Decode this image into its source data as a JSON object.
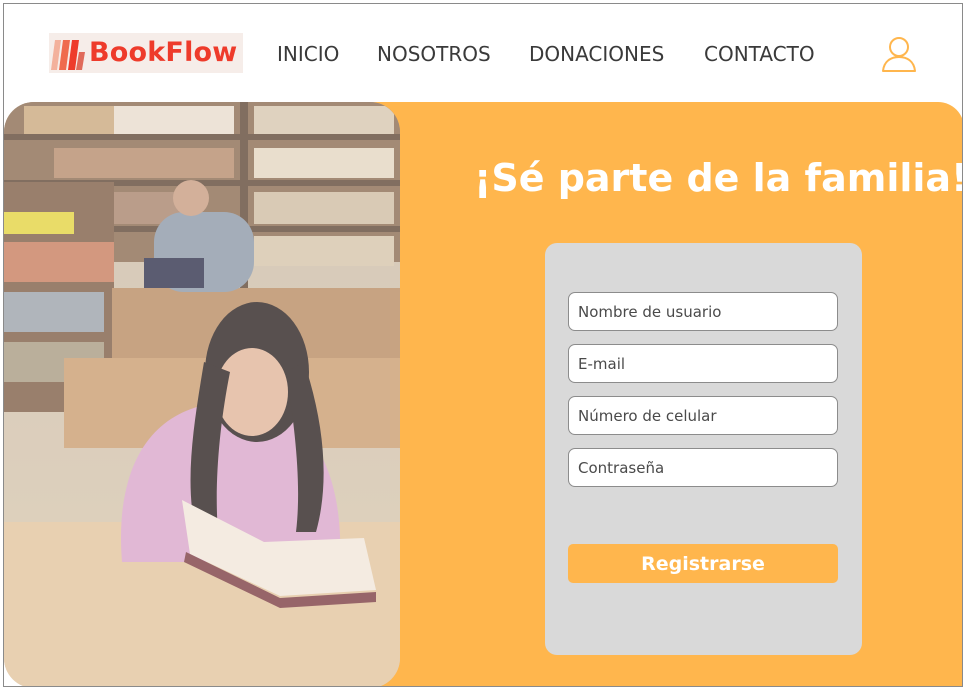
{
  "brand": {
    "name": "BookFlow",
    "color": "#ee3b2b",
    "logo_bg": "#f6ede9"
  },
  "nav": {
    "items": [
      {
        "label": "INICIO"
      },
      {
        "label": "NOSOTROS"
      },
      {
        "label": "DONACIONES"
      },
      {
        "label": "CONTACTO"
      }
    ],
    "user_icon": "user-icon"
  },
  "hero": {
    "title": "¡Sé parte de la familia!",
    "accent_color": "#ffb64d",
    "image": "library-students-photo"
  },
  "form": {
    "fields": [
      {
        "placeholder": "Nombre de usuario",
        "value": ""
      },
      {
        "placeholder": "E-mail",
        "value": ""
      },
      {
        "placeholder": "Número de celular",
        "value": ""
      },
      {
        "placeholder": "Contraseña",
        "value": ""
      }
    ],
    "submit_label": "Registrarse"
  }
}
